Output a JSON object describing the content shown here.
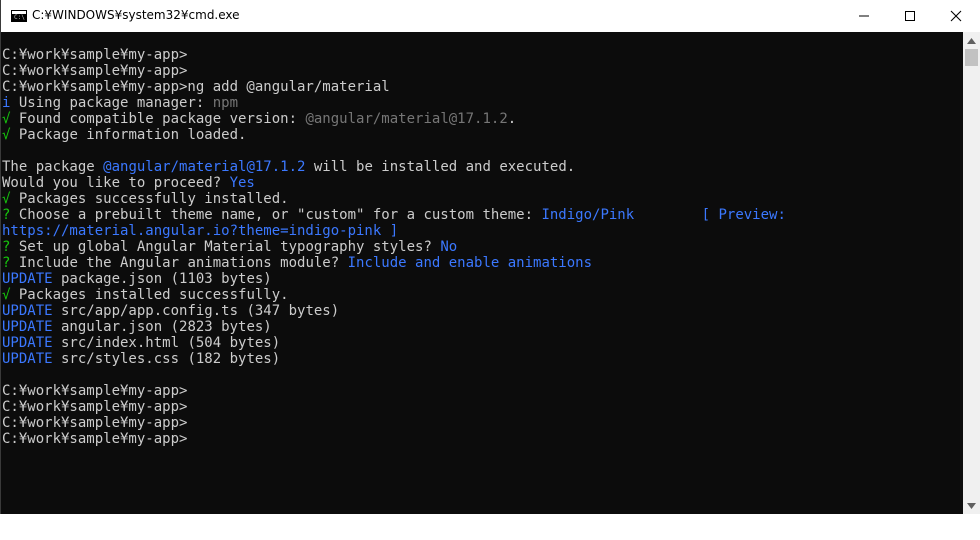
{
  "window": {
    "title": "C:¥WINDOWS¥system32¥cmd.exe",
    "icon": "cmd-icon",
    "icon_text": "C:\\",
    "controls": {
      "minimize_icon": "minimize-icon",
      "maximize_icon": "maximize-icon",
      "close_icon": "close-icon"
    }
  },
  "colors": {
    "background": "#0c0c0c",
    "text": "#cccccc",
    "blue": "#3b78ff",
    "green": "#16c60c",
    "gray": "#767676"
  },
  "console": {
    "lines": [
      [
        {
          "t": "C:¥work¥sample¥my-app>",
          "c": "text"
        }
      ],
      [
        {
          "t": "C:¥work¥sample¥my-app>",
          "c": "text"
        }
      ],
      [
        {
          "t": "C:¥work¥sample¥my-app>ng add @angular/material",
          "c": "text"
        }
      ],
      [
        {
          "t": "i",
          "c": "blue"
        },
        {
          "t": " Using package manager: ",
          "c": "text"
        },
        {
          "t": "npm",
          "c": "gray"
        }
      ],
      [
        {
          "t": "√",
          "c": "green"
        },
        {
          "t": " Found compatible package version: ",
          "c": "text"
        },
        {
          "t": "@angular/material@17.1.2",
          "c": "gray"
        },
        {
          "t": ".",
          "c": "text"
        }
      ],
      [
        {
          "t": "√",
          "c": "green"
        },
        {
          "t": " Package information loaded.",
          "c": "text"
        }
      ],
      [],
      [
        {
          "t": "The package ",
          "c": "text"
        },
        {
          "t": "@angular/material@17.1.2",
          "c": "blue"
        },
        {
          "t": " will be installed and executed.",
          "c": "text"
        }
      ],
      [
        {
          "t": "Would you like to proceed? ",
          "c": "text"
        },
        {
          "t": "Yes",
          "c": "blue"
        }
      ],
      [
        {
          "t": "√",
          "c": "green"
        },
        {
          "t": " Packages successfully installed.",
          "c": "text"
        }
      ],
      [
        {
          "t": "?",
          "c": "green"
        },
        {
          "t": " Choose a prebuilt theme name, or \"custom\" for a custom theme: ",
          "c": "text"
        },
        {
          "t": "Indigo/Pink        [ Preview:",
          "c": "blue"
        }
      ],
      [
        {
          "t": "https://material.angular.io?theme=indigo-pink ]",
          "c": "blue"
        }
      ],
      [
        {
          "t": "?",
          "c": "green"
        },
        {
          "t": " Set up global Angular Material typography styles? ",
          "c": "text"
        },
        {
          "t": "No",
          "c": "blue"
        }
      ],
      [
        {
          "t": "?",
          "c": "green"
        },
        {
          "t": " Include the Angular animations module? ",
          "c": "text"
        },
        {
          "t": "Include and enable animations",
          "c": "blue"
        }
      ],
      [
        {
          "t": "UPDATE",
          "c": "blue"
        },
        {
          "t": " package.json (1103 bytes)",
          "c": "text"
        }
      ],
      [
        {
          "t": "√",
          "c": "green"
        },
        {
          "t": " Packages installed successfully.",
          "c": "text"
        }
      ],
      [
        {
          "t": "UPDATE",
          "c": "blue"
        },
        {
          "t": " src/app/app.config.ts (347 bytes)",
          "c": "text"
        }
      ],
      [
        {
          "t": "UPDATE",
          "c": "blue"
        },
        {
          "t": " angular.json (2823 bytes)",
          "c": "text"
        }
      ],
      [
        {
          "t": "UPDATE",
          "c": "blue"
        },
        {
          "t": " src/index.html (504 bytes)",
          "c": "text"
        }
      ],
      [
        {
          "t": "UPDATE",
          "c": "blue"
        },
        {
          "t": " src/styles.css (182 bytes)",
          "c": "text"
        }
      ],
      [],
      [
        {
          "t": "C:¥work¥sample¥my-app>",
          "c": "text"
        }
      ],
      [
        {
          "t": "C:¥work¥sample¥my-app>",
          "c": "text"
        }
      ],
      [
        {
          "t": "C:¥work¥sample¥my-app>",
          "c": "text"
        }
      ],
      [
        {
          "t": "C:¥work¥sample¥my-app>",
          "c": "text"
        }
      ]
    ]
  },
  "scrollbar": {
    "up_icon": "scroll-up-arrow-icon",
    "down_icon": "scroll-down-arrow-icon"
  }
}
